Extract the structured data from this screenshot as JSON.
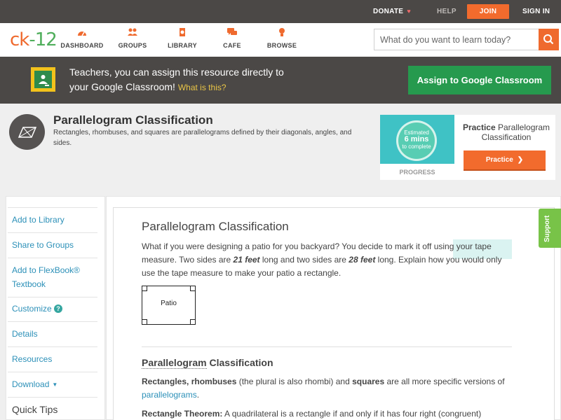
{
  "topbar": {
    "donate": "DONATE",
    "help": "HELP",
    "join": "JOIN",
    "signin": "SIGN IN",
    "heart_icon": "heart-icon"
  },
  "brand": {
    "logo_c": "ck",
    "logo_k": "-12",
    "accent": "#ef6a2e",
    "green": "#4fae5b"
  },
  "nav": {
    "items": [
      {
        "label": "DASHBOARD",
        "icon": "dashboard-gauge-icon"
      },
      {
        "label": "GROUPS",
        "icon": "groups-people-icon"
      },
      {
        "label": "LIBRARY",
        "icon": "library-book-icon"
      },
      {
        "label": "CAFE",
        "icon": "cafe-chat-icon"
      },
      {
        "label": "BROWSE",
        "icon": "browse-bulb-icon"
      }
    ],
    "search_placeholder": "What do you want to learn today?"
  },
  "banner": {
    "line1": "Teachers, you can assign this resource directly to",
    "line2": "your Google Classroom!",
    "what": "What is this?",
    "assign": "Assign to Google Classroom"
  },
  "concept": {
    "title": "Parallelogram Classification",
    "description": "Rectangles, rhombuses, and squares are parallelograms defined by their diagonals, angles, and sides."
  },
  "practice": {
    "estimated": "Estimated",
    "mins": "6 mins",
    "complete": "to complete",
    "progress": "PROGRESS",
    "prefix": "Practice",
    "title": "Parallelogram Classification",
    "button": "Practice"
  },
  "sidebar": {
    "items": [
      "Add to Library",
      "Share to Groups",
      "Add to FlexBook®",
      "Textbook",
      "Customize",
      "Details",
      "Resources",
      "Download"
    ],
    "quick_tips": "Quick Tips"
  },
  "content": {
    "title": "Parallelogram Classification",
    "intro_a": "What if you were designing a patio for you backyard? You decide to mark it off using your tape measure. Two sides are ",
    "intro_b1": "21 feet",
    "intro_c": " long and two sides are ",
    "intro_b2": "28 feet",
    "intro_d": " long. Explain how you would only use the tape measure to make your patio a rectangle.",
    "patio_label": "Patio",
    "section_title_u": "Parallelogram",
    "section_title_rest": " Classification",
    "p1_b1": "Rectangles, rhombuses",
    "p1_a": " (the plural is also rhombi) and ",
    "p1_b2": "squares",
    "p1_c": " are all more specific versions of ",
    "p1_link": "parallelograms",
    "p1_d": ".",
    "p2_b": "Rectangle Theorem:",
    "p2_a": " A quadrilateral is a rectangle if and only if it has four right (congruent)"
  },
  "support": "Support"
}
